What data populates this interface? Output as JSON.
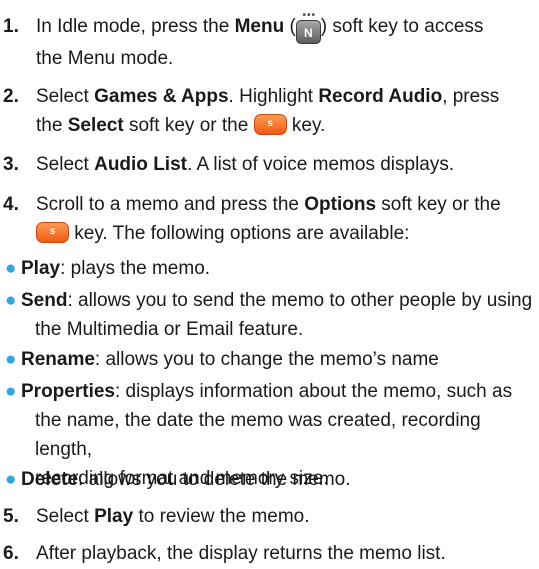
{
  "steps": [
    {
      "num": "1.",
      "parts": [
        "In Idle mode, press the ",
        "Menu",
        " (",
        ") soft key to access",
        "the Menu mode."
      ],
      "menu_key_glyph": "N"
    },
    {
      "num": "2.",
      "parts": [
        "Select ",
        "Games & Apps",
        ". Highlight ",
        "Record Audio",
        ", press",
        "the ",
        "Select",
        " soft key or the ",
        " key."
      ]
    },
    {
      "num": "3.",
      "parts": [
        "Select ",
        "Audio List",
        ". A list of voice memos displays."
      ]
    },
    {
      "num": "4.",
      "parts": [
        "Scroll to a memo and press the ",
        "Options",
        " soft key or the",
        " key. The following options are available:"
      ]
    },
    {
      "num": "5.",
      "parts": [
        "Select ",
        "Play",
        " to review the memo."
      ]
    },
    {
      "num": "6.",
      "parts": [
        "After playback, the display returns the memo list."
      ]
    }
  ],
  "options": [
    {
      "name": "Play",
      "desc": ": plays the memo."
    },
    {
      "name": "Send",
      "desc": ": allows you to send the memo to other people by using",
      "desc2": "the Multimedia or Email feature."
    },
    {
      "name": "Rename",
      "desc": ": allows you to change the memo’s name"
    },
    {
      "name": "Properties",
      "desc": ": displays information about the memo, such as",
      "desc2": "the name, the date the memo was created, recording length,",
      "desc3": "recording format and memory size."
    },
    {
      "name": "Delete",
      "desc": ": allows you to delete the memo."
    }
  ],
  "icons": {
    "menu_key": "menu-softkey-icon",
    "ok_key": "orange-select-key-icon"
  },
  "colors": {
    "bullet": "#2aa8df",
    "ok_key": "#f36b21",
    "text": "#1a1a1a"
  }
}
